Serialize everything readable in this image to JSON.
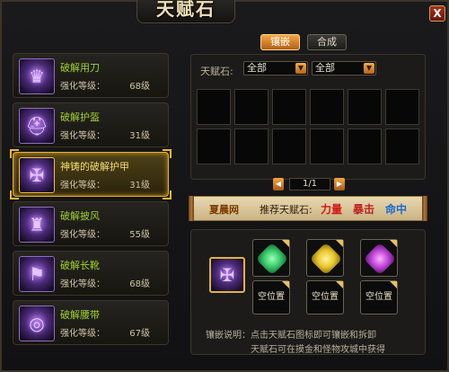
{
  "window": {
    "title": "天赋石",
    "close_label": "X"
  },
  "tabs": [
    {
      "label": "镶嵌",
      "active": true
    },
    {
      "label": "合成",
      "active": false
    }
  ],
  "items": [
    {
      "name": "破解用刀",
      "level_label": "强化等级：",
      "level": "68级",
      "icon": "spiked-helmet-icon"
    },
    {
      "name": "破解护盔",
      "level_label": "强化等级：",
      "level": "31级",
      "icon": "helmet-icon"
    },
    {
      "name": "神铸的破解护甲",
      "level_label": "强化等级：",
      "level": "31级",
      "icon": "armor-icon",
      "selected": true
    },
    {
      "name": "破解披风",
      "level_label": "强化等级：",
      "level": "55级",
      "icon": "cape-icon"
    },
    {
      "name": "破解长靴",
      "level_label": "强化等级：",
      "level": "68级",
      "icon": "boots-icon"
    },
    {
      "name": "破解腰带",
      "level_label": "强化等级：",
      "level": "67级",
      "icon": "belt-icon"
    }
  ],
  "filter": {
    "label": "天赋石:",
    "select1": "全部",
    "select2": "全部"
  },
  "pager": {
    "text": "1/1",
    "prev": "◀",
    "next": "▶"
  },
  "banner": {
    "job": "夏晨网",
    "recommend": "推荐天赋石:",
    "stones": [
      {
        "text": "力量",
        "color": "#d01818"
      },
      {
        "text": "暴击",
        "color": "#c02020"
      },
      {
        "text": "命中",
        "color": "#1a6ad0"
      }
    ]
  },
  "sockets": {
    "empty_label": "空位置",
    "gems": [
      {
        "name": "green-gem-icon",
        "color": "#39c96a"
      },
      {
        "name": "yellow-gem-icon",
        "color": "#e8c82c"
      },
      {
        "name": "purple-gem-icon",
        "color": "#c046d8"
      }
    ]
  },
  "info": {
    "line1": "镶嵌说明：点击天赋石图标即可镶嵌和拆卸",
    "line2": "天赋石可在摸金和怪物攻城中获得"
  },
  "colors": {
    "accent_gold": "#e0b43a",
    "item_name_green": "#a0d030",
    "tab_orange": "#f4a640"
  }
}
